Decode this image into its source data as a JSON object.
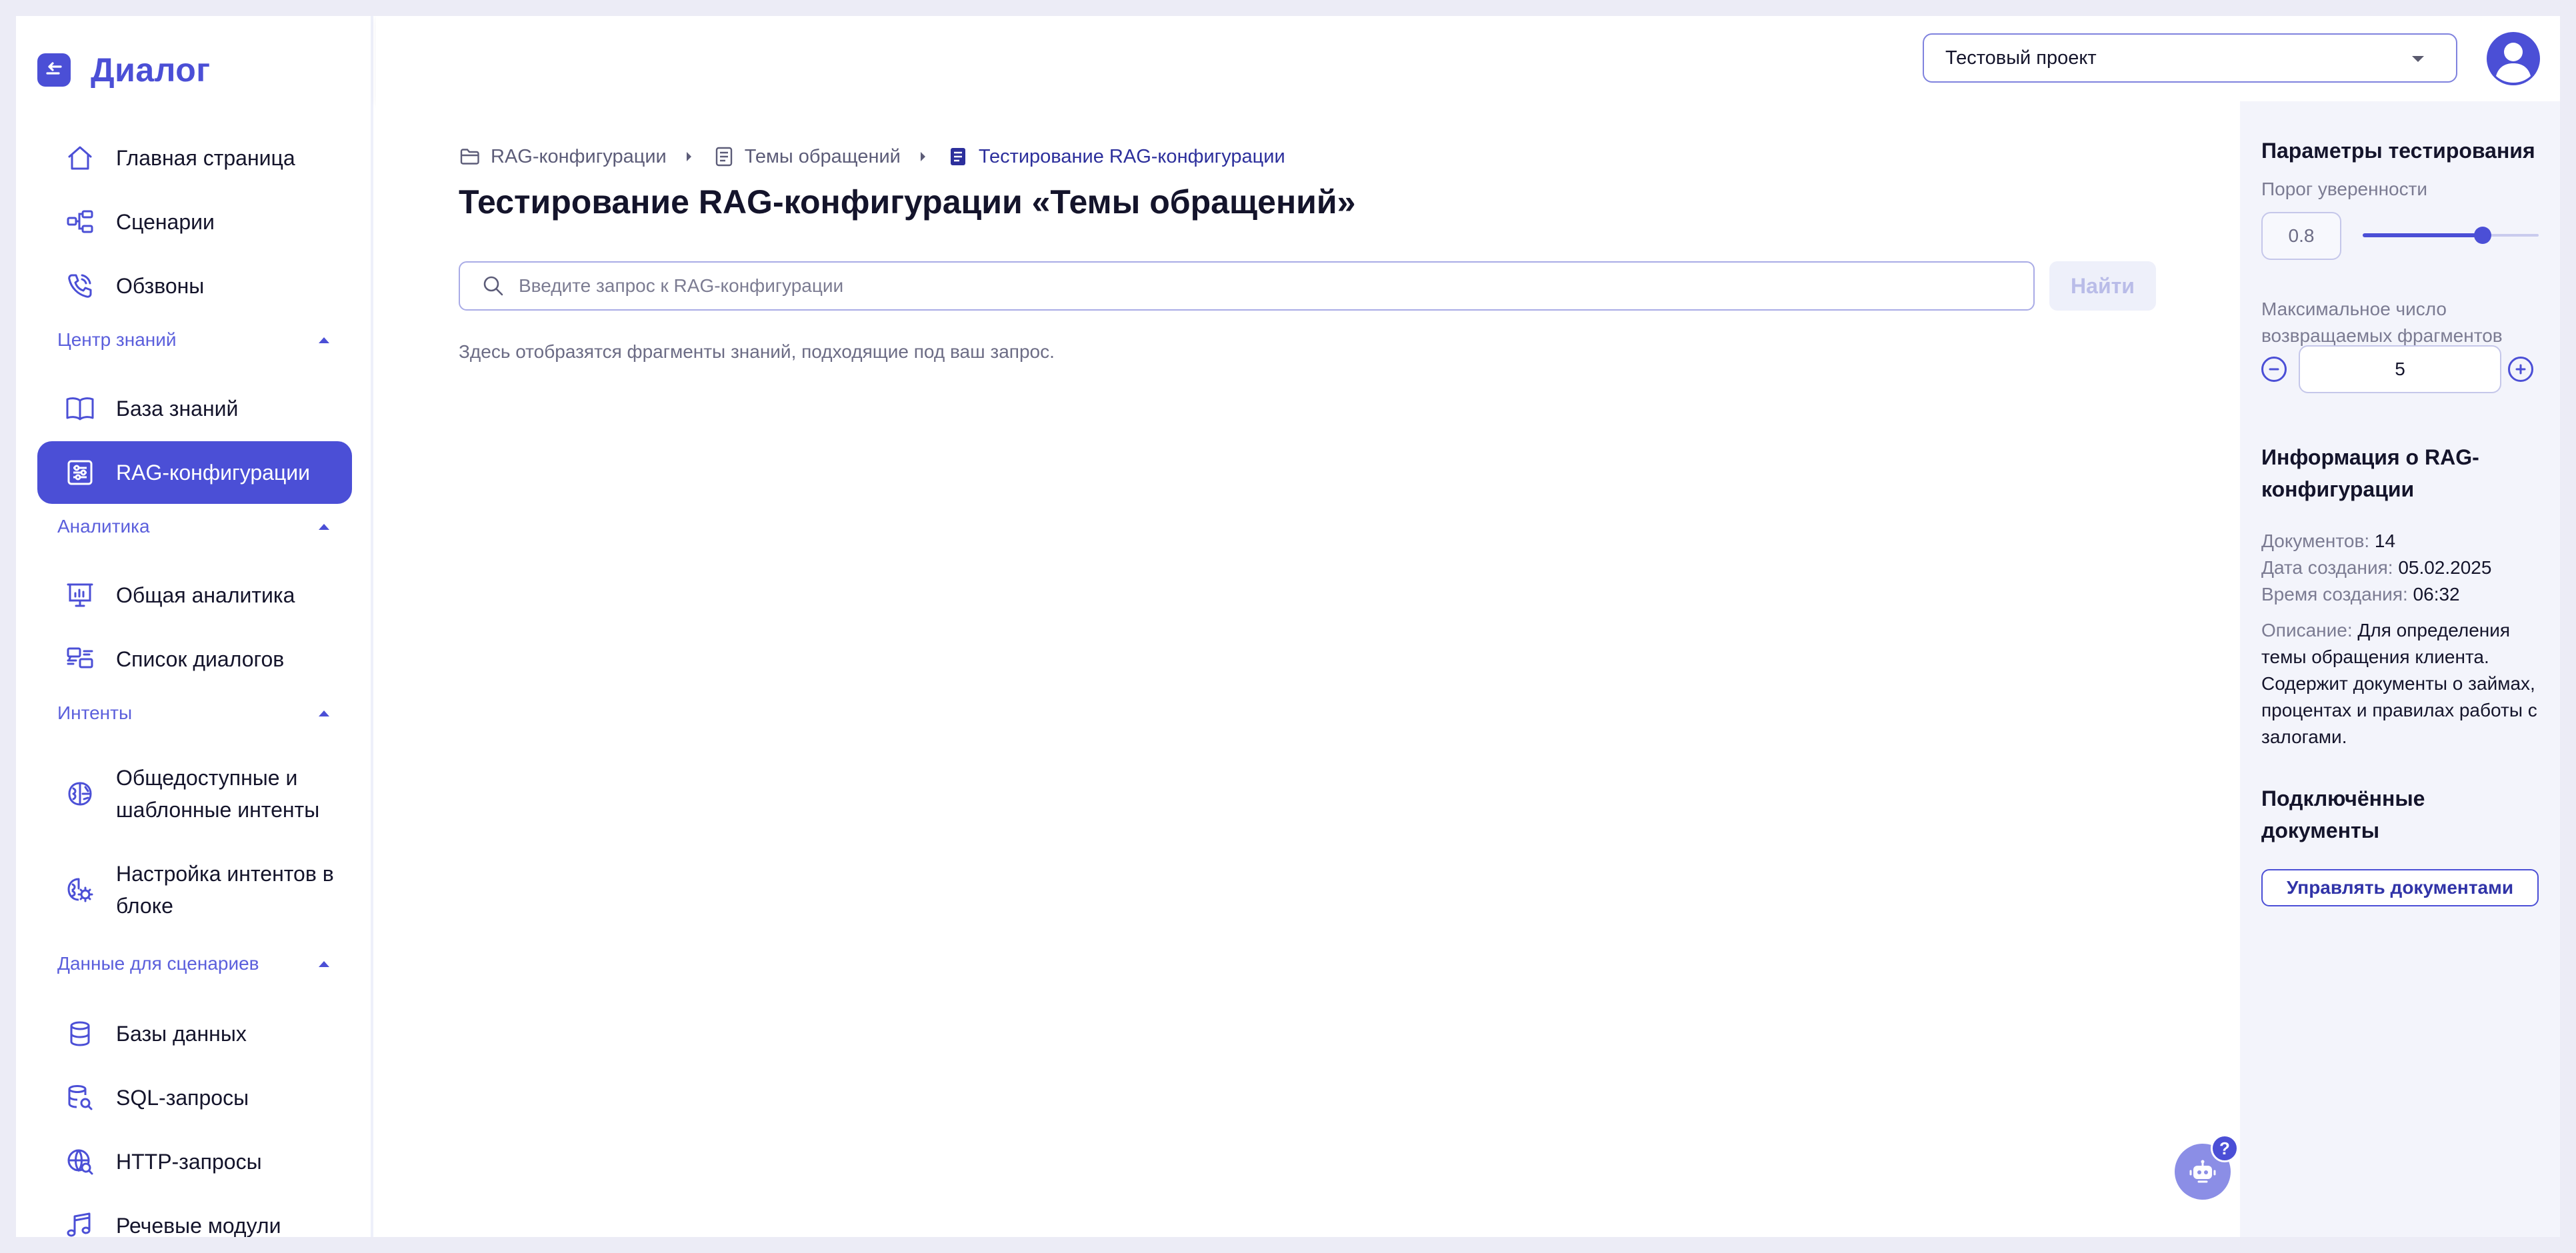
{
  "app": {
    "name": "Диалог"
  },
  "sidebar": {
    "items": [
      {
        "id": "home",
        "label": "Главная страница"
      },
      {
        "id": "scenarios",
        "label": "Сценарии"
      },
      {
        "id": "calls",
        "label": "Обзвоны"
      },
      {
        "id": "kb",
        "label": "База знаний"
      },
      {
        "id": "rag",
        "label": "RAG-конфигурации",
        "active": true
      },
      {
        "id": "analytics",
        "label": "Общая аналитика"
      },
      {
        "id": "dialogs",
        "label": "Список диалогов"
      },
      {
        "id": "intents_public",
        "label": "Общедоступные и шаблонные интенты"
      },
      {
        "id": "intents_block",
        "label": "Настройка интентов в блоке"
      },
      {
        "id": "databases",
        "label": "Базы данных"
      },
      {
        "id": "sql",
        "label": "SQL-запросы"
      },
      {
        "id": "http",
        "label": "HTTP-запросы"
      },
      {
        "id": "speech",
        "label": "Речевые модули"
      }
    ],
    "sections": {
      "knowledge": "Центр знаний",
      "analytics": "Аналитика",
      "intents": "Интенты",
      "data": "Данные для сценариев"
    }
  },
  "header": {
    "project": "Тестовый проект"
  },
  "breadcrumb": {
    "items": [
      "RAG-конфигурации",
      "Темы обращений",
      "Тестирование RAG-конфигурации"
    ]
  },
  "main": {
    "title": "Тестирование RAG-конфигурации «Темы обращений»",
    "search_placeholder": "Введите запрос к RAG-конфигурации",
    "find_label": "Найти",
    "hint": "Здесь отобразятся фрагменты знаний, подходящие под ваш запрос.",
    "help_badge": "?"
  },
  "panel": {
    "params_title": "Параметры тестирования",
    "threshold_label": "Порог уверенности",
    "threshold_value": "0.8",
    "threshold_level": 0.68,
    "max_fragments_label": "Максимальное число возвращаемых фрагментов",
    "max_fragments_value": "5",
    "info_title": "Информация о RAG-конфигурации",
    "docs_label": "Документов:",
    "docs_value": "14",
    "created_date_label": "Дата создания:",
    "created_date_value": "05.02.2025",
    "created_time_label": "Время создания:",
    "created_time_value": "06:32",
    "description_label": "Описание:",
    "description_value": "Для определения темы обращения клиента. Содержит документы о займах, процентах и правилах работы с залогами.",
    "connected_title": "Подключённые документы",
    "manage_button": "Управлять документами"
  },
  "colors": {
    "accent": "#4b4fd6",
    "accent_light": "#eef0fa",
    "panel_bg": "#f3f4fb"
  }
}
